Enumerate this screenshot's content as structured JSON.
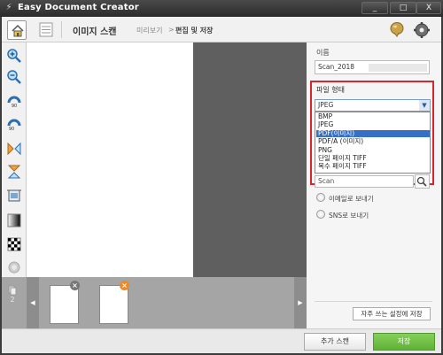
{
  "window": {
    "title": "Easy Document Creator",
    "min_label": "_",
    "max_label": "□",
    "close_label": "X"
  },
  "toolbar": {
    "mode_title": "이미지 스캔",
    "breadcrumb_preview": "미리보기",
    "breadcrumb_sep": ">",
    "breadcrumb_edit": "편집 및 저장"
  },
  "thumbnails": {
    "page_count": "2",
    "remove_label": "×"
  },
  "panel": {
    "name_label": "이름",
    "name_value": "Scan_2018",
    "format_label": "파일 형태",
    "format_selected": "JPEG",
    "format_options": [
      "BMP",
      "JPEG",
      "PDF(이미지)",
      "PDF/A (이미지)",
      "PNG",
      "단일 페이지 TIFF",
      "복수 페이지 TIFF"
    ],
    "highlighted_option": "PDF(이미지)",
    "search_value": "Scan",
    "email_label": "이메일로 보내기",
    "sns_label": "SNS로 보내기",
    "preset_button": "자주 쓰는 설정에 저장"
  },
  "footer": {
    "add_scan_label": "추가 스캔",
    "save_label": "저장"
  },
  "colors": {
    "highlight_border": "#d9262e",
    "selected_option": "#3670c7",
    "save_button": "#6dbd42"
  }
}
